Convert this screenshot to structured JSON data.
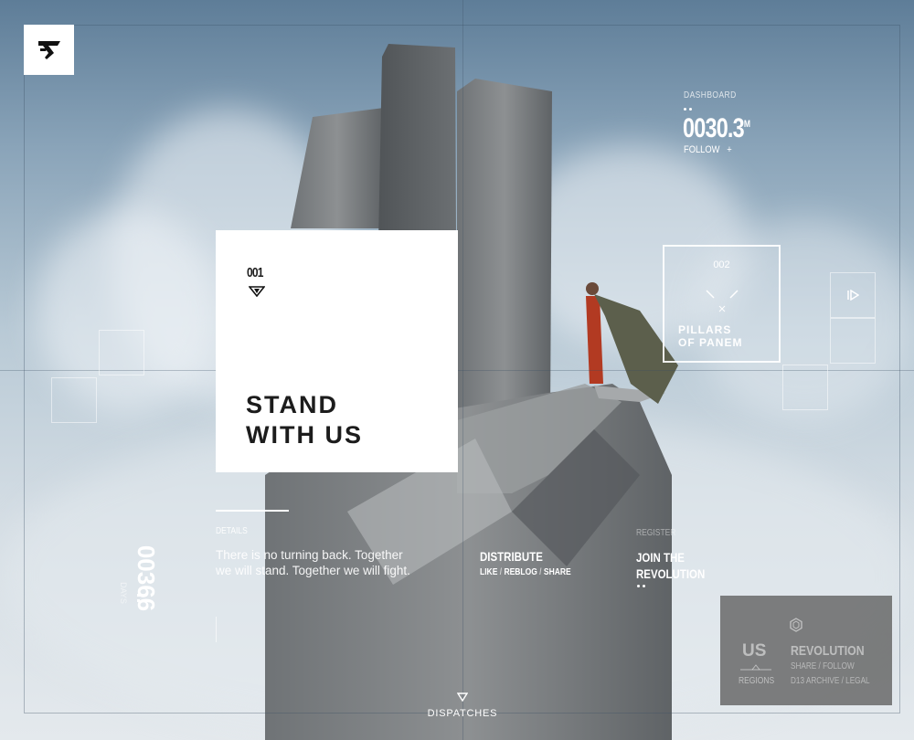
{
  "brand": {
    "logo_icon": "brand-logo-icon"
  },
  "feature": {
    "number": "001",
    "title_line1": "STAND",
    "title_line2": "WITH US"
  },
  "dashboard": {
    "label": "DASHBOARD",
    "value": "0030.3",
    "unit": "M",
    "follow": "FOLLOW",
    "follow_icon": "+"
  },
  "pillars": {
    "number": "002",
    "line1": "PILLARS",
    "line2": "OF PANEM"
  },
  "details": {
    "label": "DETAILS",
    "text": "There is no turning back. Together we will stand. Together we will fight."
  },
  "side": {
    "number": "00366",
    "label": "DAYS"
  },
  "distribute": {
    "title": "DISTRIBUTE",
    "like": "LIKE",
    "reblog": "REBLOG",
    "share": "SHARE",
    "sep": "/"
  },
  "join": {
    "label": "REGISTER",
    "line1": "JOIN THE",
    "line2": "REVOLUTION"
  },
  "revolution": {
    "us": "US",
    "regions": "REGIONS",
    "title": "REVOLUTION",
    "links1": "SHARE / FOLLOW",
    "links2": "D13 ARCHIVE / LEGAL"
  },
  "dispatches": {
    "label": "DISPATCHES"
  }
}
